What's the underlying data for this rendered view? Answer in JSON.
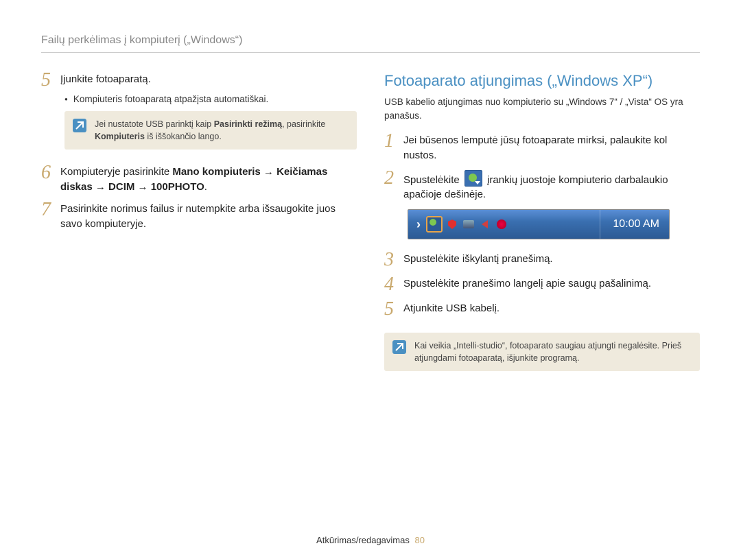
{
  "header": {
    "breadcrumb": "Failų perkėlimas į kompiuterį („Windows“)"
  },
  "left": {
    "steps": {
      "s5": {
        "num": "5",
        "title": "Įjunkite fotoaparatą.",
        "bullet": "Kompiuteris fotoaparatą atpažįsta automatiškai."
      },
      "note5": {
        "pre": "Jei nustatote USB parinktį kaip ",
        "b1": "Pasirinkti režimą",
        "mid": ", pasirinkite ",
        "b2": "Kompiuteris",
        "post": " iš iššokančio lango."
      },
      "s6": {
        "num": "6",
        "pre": "Kompiuteryje pasirinkite ",
        "b1": "Mano kompiuteris → Keičiamas diskas → DCIM → 100PHOTO",
        "post": "."
      },
      "s7": {
        "num": "7",
        "text": "Pasirinkite norimus failus ir nutempkite arba išsaugokite juos savo kompiuteryje."
      }
    }
  },
  "right": {
    "title": "Fotoaparato atjungimas („Windows XP“)",
    "intro": "USB kabelio atjungimas nuo kompiuterio su „Windows 7“ / „Vista“ OS yra panašus.",
    "steps": {
      "s1": {
        "num": "1",
        "text": "Jei būsenos lemputė jūsų fotoaparate mirksi, palaukite kol nustos."
      },
      "s2": {
        "num": "2",
        "pre": "Spustelėkite ",
        "post": " įrankių juostoje kompiuterio darbalaukio apačioje dešinėje."
      },
      "s3": {
        "num": "3",
        "text": "Spustelėkite iškylantį pranešimą."
      },
      "s4": {
        "num": "4",
        "text": "Spustelėkite pranešimo langelį apie saugų pašalinimą."
      },
      "s5": {
        "num": "5",
        "text": "Atjunkite USB kabelį."
      }
    },
    "taskbar": {
      "clock": "10:00 AM"
    },
    "note": "Kai veikia „Intelli-studio“, fotoaparato saugiau atjungti negalėsite. Prieš atjungdami fotoaparatą, išjunkite programą."
  },
  "footer": {
    "section": "Atkūrimas/redagavimas",
    "page": "80"
  }
}
